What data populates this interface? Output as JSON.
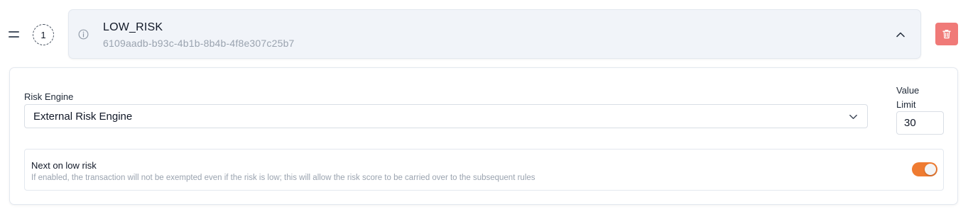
{
  "rule": {
    "order": "1",
    "name": "LOW_RISK",
    "id": "6109aadb-b93c-4b1b-8b4b-4f8e307c25b7",
    "expanded": true
  },
  "icons": {
    "drag": "drag-handle-icon",
    "info": "info-icon",
    "collapse": "chevron-up-icon",
    "delete": "trash-icon",
    "select": "chevron-down-icon"
  },
  "risk_engine": {
    "label": "Risk Engine",
    "value": "External Risk Engine"
  },
  "value_limit": {
    "label": "Value Limit",
    "value": "30"
  },
  "next_on_low_risk": {
    "title": "Next on low risk",
    "description": "If enabled, the transaction will not be exempted even if the risk is low; this will allow the risk score to be carried over to the subsequent rules",
    "enabled": true
  },
  "colors": {
    "accent": "#ef7b31",
    "danger": "#f07a78",
    "header_bg": "#f1f4f9",
    "muted_text": "#9aa3af"
  }
}
